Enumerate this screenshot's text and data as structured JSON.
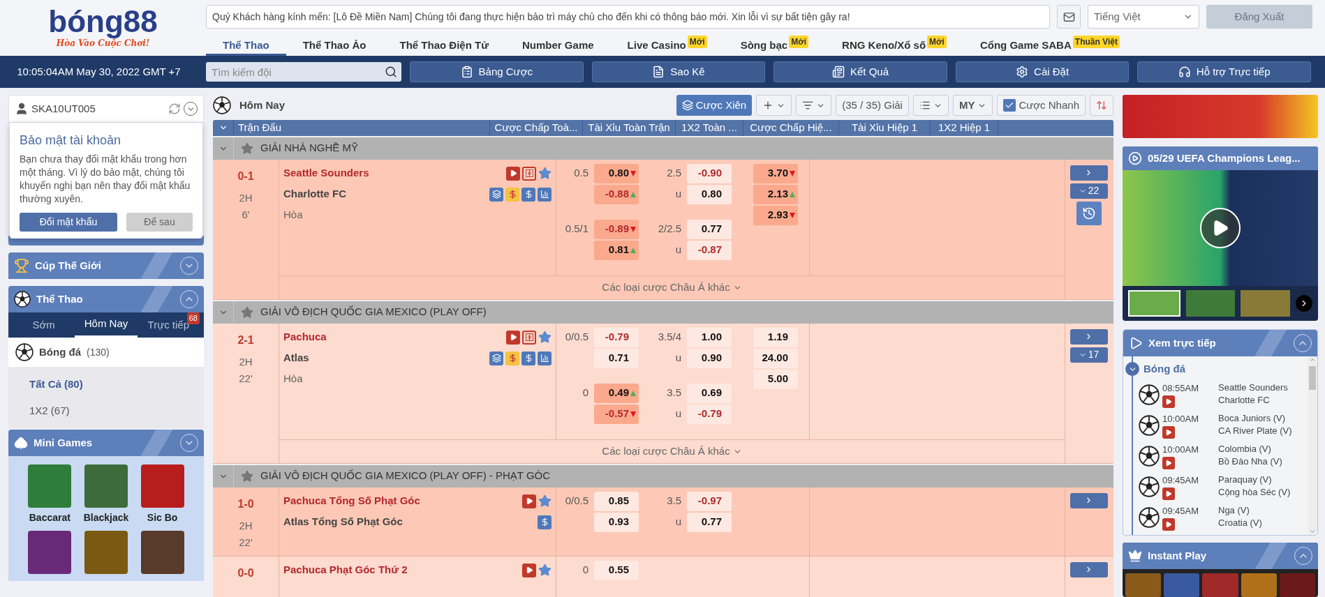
{
  "header": {
    "logo": {
      "name": "bóng88",
      "slogan": "Hòa Vào Cuộc Chơi!"
    },
    "notice": "Quý Khách hàng kính mến: [Lô Đề Miền Nam] Chúng tôi đang thực hiện bảo trì máy chủ cho đến khi có thông báo mới. Xin lỗi vì sự bất tiện gây ra!",
    "language": "Tiếng Việt",
    "logout": "Đăng Xuất",
    "tabs": [
      {
        "label": "Thể Thao",
        "selected": true
      },
      {
        "label": "Thể Thao Ảo",
        "selected": false
      },
      {
        "label": "Thể Thao Điện Tử",
        "selected": false
      },
      {
        "label": "Number Game",
        "selected": false
      },
      {
        "label": "Live Casino",
        "badge": "Mới",
        "selected": false
      },
      {
        "label": "Sòng bạc",
        "badge": "Mới",
        "selected": false
      },
      {
        "label": "RNG Keno/Xổ số",
        "badge": "Mới",
        "selected": false
      },
      {
        "label": "Cổng Game SABA",
        "badge": "Thuần Việt",
        "selected": false
      }
    ]
  },
  "toolbar": {
    "clock": "10:05:04AM May 30, 2022 GMT +7",
    "search": {
      "placeholder": "Tìm kiếm đội"
    },
    "buttons": [
      {
        "label": "Bảng Cược",
        "kind": "sheet"
      },
      {
        "label": "Sao Kê",
        "kind": "statement"
      },
      {
        "label": "Kết Quả",
        "kind": "result"
      },
      {
        "label": "Cài Đặt",
        "kind": "settings"
      },
      {
        "label": "Hỗ trợ Trực tiếp",
        "kind": "support"
      }
    ]
  },
  "sidebar": {
    "user": "SKA10UT005",
    "security_popup": {
      "title": "Bảo mật tài khoản",
      "message": "Bạn chưa thay đổi mật khẩu trong hơn một tháng. Vì lý do bảo mật, chúng tôi khuyến nghị bạn nên thay đổi mật khẩu thường xuyên.",
      "primary": "Đổi mật khẩu",
      "secondary": "Để sau"
    },
    "world_cup": {
      "title": "Cúp Thế Giới",
      "expanded": false
    },
    "sports": {
      "title": "Thể Thao",
      "expanded": true,
      "tabs": [
        {
          "label": "Sớm",
          "selected": false
        },
        {
          "label": "Hôm Nay",
          "selected": true
        },
        {
          "label": "Trực tiếp",
          "badge": "68",
          "selected": false
        }
      ],
      "sport": {
        "name": "Bóng đá",
        "count": "(130)"
      },
      "filters": [
        {
          "label": "Tất Cả (80)",
          "selected": true
        },
        {
          "label": "1X2 (67)",
          "selected": false
        }
      ]
    },
    "mini_games": {
      "title": "Mini Games",
      "expanded": false,
      "games": [
        {
          "label": "Baccarat"
        },
        {
          "label": "Blackjack"
        },
        {
          "label": "Sic Bo"
        }
      ]
    }
  },
  "main": {
    "title": "Hôm Nay",
    "tools": [
      {
        "kind": "parlay",
        "label": "Cược Xiên"
      },
      {
        "kind": "add"
      },
      {
        "kind": "sort"
      },
      {
        "kind": "leagues",
        "label": "(35 / 35) Giải"
      },
      {
        "kind": "view"
      },
      {
        "kind": "odds_type",
        "label": "MY"
      },
      {
        "kind": "quick_bet",
        "label": "Cược Nhanh",
        "checked": true
      },
      {
        "kind": "arrows"
      }
    ],
    "table": {
      "columns": [
        "Trận Đấu",
        "Cược Chấp Toà...",
        "Tài Xỉu Toàn Trận",
        "1X2 Toàn ...",
        "Cược Chấp Hiệ...",
        "Tài Xỉu Hiệp 1",
        "1X2 Hiệp 1"
      ],
      "leagues": [
        {
          "name": "GIẢI NHÀ NGHỀ MỸ",
          "matches": [
            {
              "score": "0-1",
              "period": "2H",
              "minute": "6'",
              "home": "Seattle Sounders",
              "away": "Charlotte FC",
              "draw": "Hòa",
              "home_icons": [
                {
                  "kind": "live"
                },
                {
                  "kind": "field"
                },
                {
                  "kind": "favorite"
                }
              ],
              "away_icons": [
                {
                  "kind": "parlay"
                },
                {
                  "kind": "cashout"
                },
                {
                  "kind": "dollar"
                },
                {
                  "kind": "stats"
                }
              ],
              "handicap": [
                {
                  "line": "0.5",
                  "home": {
                    "value": "0.80",
                    "negative": false,
                    "highlighted": true,
                    "rising": false
                  },
                  "away": {
                    "value": "-0.88",
                    "negative": true,
                    "highlighted": true,
                    "rising": true
                  }
                },
                {
                  "line": "0.5/1",
                  "home": {
                    "value": "-0.89",
                    "negative": true,
                    "highlighted": true,
                    "rising": false
                  },
                  "away": {
                    "value": "0.81",
                    "negative": false,
                    "highlighted": true,
                    "rising": true
                  }
                }
              ],
              "over_under": [
                {
                  "line": "2.5",
                  "under_label": "u",
                  "over": {
                    "value": "-0.90",
                    "negative": true,
                    "highlighted": false
                  },
                  "under": {
                    "value": "0.80",
                    "negative": false,
                    "highlighted": false
                  }
                },
                {
                  "line": "2/2.5",
                  "under_label": "u",
                  "over": {
                    "value": "0.77",
                    "negative": false,
                    "highlighted": false
                  },
                  "under": {
                    "value": "-0.87",
                    "negative": true,
                    "highlighted": false
                  }
                }
              ],
              "x12": [
                {
                  "value": "3.70",
                  "negative": false,
                  "highlighted": true,
                  "rising": false
                },
                {
                  "value": "2.13",
                  "negative": false,
                  "highlighted": true,
                  "rising": true
                },
                {
                  "value": "2.93",
                  "negative": false,
                  "highlighted": true,
                  "rising": false
                }
              ],
              "more_bets": "Các loại cược Châu Á khác",
              "bet_count": "22",
              "history": true
            }
          ]
        },
        {
          "name": "GIẢI VÔ ĐỊCH QUỐC GIA MEXICO (PLAY OFF)",
          "matches": [
            {
              "score": "2-1",
              "period": "2H",
              "minute": "22'",
              "home": "Pachuca",
              "away": "Atlas",
              "draw": "Hòa",
              "home_icons": [
                {
                  "kind": "live"
                },
                {
                  "kind": "field"
                },
                {
                  "kind": "favorite"
                }
              ],
              "away_icons": [
                {
                  "kind": "parlay"
                },
                {
                  "kind": "cashout"
                },
                {
                  "kind": "dollar"
                },
                {
                  "kind": "stats"
                }
              ],
              "handicap": [
                {
                  "line": "0/0.5",
                  "home": {
                    "value": "-0.79",
                    "negative": true,
                    "highlighted": false
                  },
                  "away": {
                    "value": "0.71",
                    "negative": false,
                    "highlighted": false
                  }
                },
                {
                  "line": "0",
                  "home": {
                    "value": "0.49",
                    "negative": false,
                    "highlighted": true,
                    "rising": true
                  },
                  "away": {
                    "value": "-0.57",
                    "negative": true,
                    "highlighted": true,
                    "rising": false
                  }
                }
              ],
              "over_under": [
                {
                  "line": "3.5/4",
                  "under_label": "u",
                  "over": {
                    "value": "1.00",
                    "negative": false,
                    "highlighted": false
                  },
                  "under": {
                    "value": "0.90",
                    "negative": false,
                    "highlighted": false
                  }
                },
                {
                  "line": "3.5",
                  "under_label": "u",
                  "over": {
                    "value": "0.69",
                    "negative": false,
                    "highlighted": false
                  },
                  "under": {
                    "value": "-0.79",
                    "negative": true,
                    "highlighted": false
                  }
                }
              ],
              "x12": [
                {
                  "value": "1.19",
                  "negative": false,
                  "highlighted": false
                },
                {
                  "value": "24.00",
                  "negative": false,
                  "highlighted": false
                },
                {
                  "value": "5.00",
                  "negative": false,
                  "highlighted": false
                }
              ],
              "more_bets": "Các loại cược Châu Á khác",
              "bet_count": "17",
              "history": false
            }
          ]
        },
        {
          "name": "GIẢI VÔ ĐỊCH QUỐC GIA MEXICO (PLAY OFF) - PHẠT GÓC",
          "matches": [
            {
              "score": "1-0",
              "period": "2H",
              "minute": "22'",
              "home": "Pachuca Tổng Số Phạt Góc",
              "away": "Atlas Tổng Số Phạt Góc",
              "home_icons": [
                {
                  "kind": "live"
                },
                {
                  "kind": "favorite"
                }
              ],
              "away_icons": [
                {
                  "kind": "dollar"
                }
              ],
              "handicap": [
                {
                  "line": "0/0.5",
                  "home": {
                    "value": "0.85",
                    "negative": false,
                    "highlighted": false
                  },
                  "away": {
                    "value": "0.93",
                    "negative": false,
                    "highlighted": false
                  }
                }
              ],
              "over_under": [
                {
                  "line": "3.5",
                  "under_label": "u",
                  "over": {
                    "value": "-0.97",
                    "negative": true,
                    "highlighted": false
                  },
                  "under": {
                    "value": "0.77",
                    "negative": false,
                    "highlighted": false
                  }
                }
              ],
              "history": false
            },
            {
              "score": "0-0",
              "home": "Pachuca Phạt Góc Thứ 2",
              "home_icons": [
                {
                  "kind": "live"
                },
                {
                  "kind": "favorite"
                }
              ],
              "handicap": [
                {
                  "line": "0",
                  "home": {
                    "value": "0.55",
                    "negative": false,
                    "highlighted": false
                  }
                }
              ],
              "history": false
            }
          ]
        }
      ]
    }
  },
  "right": {
    "video": {
      "title": "05/29 UEFA Champions Leag..."
    },
    "live": {
      "title": "Xem trực tiếp",
      "expanded": true,
      "sport": "Bóng đá",
      "matches": [
        {
          "time": "08:55AM",
          "home": "Seattle Sounders",
          "away": "Charlotte FC"
        },
        {
          "time": "10:00AM",
          "home": "Boca Juniors (V)",
          "away": "CA River Plate (V)"
        },
        {
          "time": "10:00AM",
          "home": "Colombia (V)",
          "away": "Bồ Đào Nha (V)"
        },
        {
          "time": "09:45AM",
          "home": "Paraquay (V)",
          "away": "Cộng hòa Séc (V)"
        },
        {
          "time": "09:45AM",
          "home": "Nga (V)",
          "away": "Croatia (V)"
        }
      ]
    },
    "instant_play": {
      "title": "Instant Play",
      "expanded": true
    }
  }
}
